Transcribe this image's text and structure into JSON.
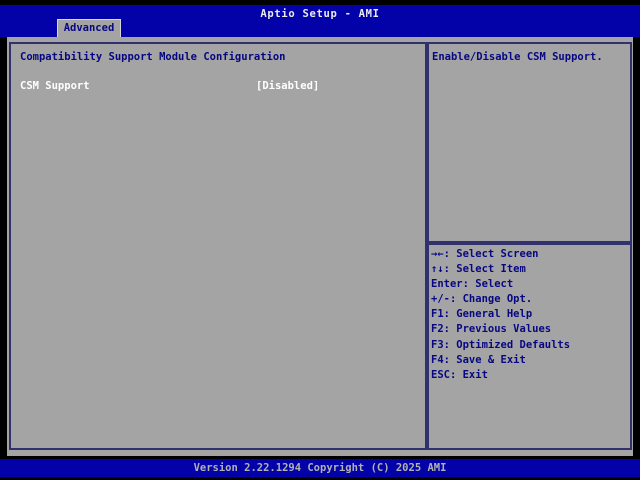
{
  "header": {
    "title": "Aptio Setup - AMI",
    "tab": "Advanced"
  },
  "main": {
    "section_title": "Compatibility Support Module Configuration",
    "items": [
      {
        "label": "CSM Support",
        "value": "[Disabled]",
        "selected": true
      }
    ]
  },
  "help_panel": {
    "description": "Enable/Disable CSM Support."
  },
  "key_legend": [
    "→←: Select Screen",
    "↑↓: Select Item",
    "Enter: Select",
    "+/-: Change Opt.",
    "F1: General Help",
    "F2: Previous Values",
    "F3: Optimized Defaults",
    "F4: Save & Exit",
    "ESC: Exit"
  ],
  "footer": {
    "version_text": "Version 2.22.1294 Copyright (C) 2025 AMI"
  },
  "colors": {
    "header_blue": "#0202a8",
    "panel_gray": "#a4a4a4",
    "text_navy": "#070782",
    "selected_text": "#ffffff",
    "border_navy": "#31316e",
    "footer_text": "#b2b2b2",
    "background_black": "#000000"
  }
}
